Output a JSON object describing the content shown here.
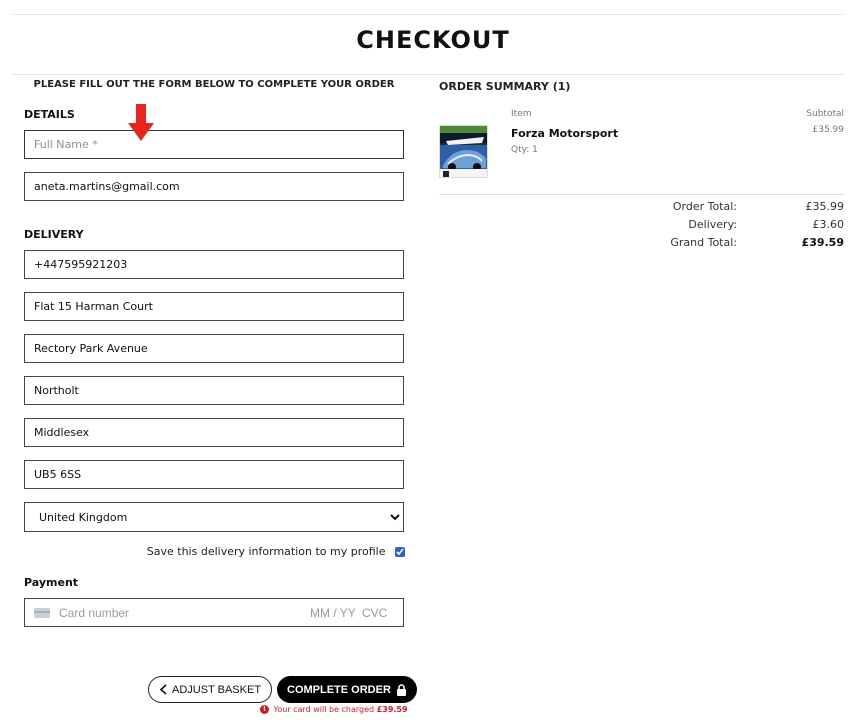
{
  "page": {
    "title": "CHECKOUT",
    "intro": "PLEASE FILL OUT THE FORM BELOW TO COMPLETE YOUR ORDER"
  },
  "details": {
    "label": "DETAILS",
    "full_name_placeholder": "Full Name *",
    "full_name_value": "",
    "email_value": "aneta.martins@gmail.com"
  },
  "delivery": {
    "label": "DELIVERY",
    "phone": "+447595921203",
    "address1": "Flat 15 Harman Court",
    "address2": "Rectory Park Avenue",
    "town": "Northolt",
    "county": "Middlesex",
    "postcode": "UB5 6SS",
    "country": "United Kingdom",
    "save_label": "Save this delivery information to my profile",
    "save_checked": true
  },
  "payment": {
    "label": "Payment",
    "card_placeholder": "Card number",
    "expiry_placeholder": "MM / YY",
    "cvc_placeholder": "CVC"
  },
  "actions": {
    "adjust_label": "ADJUST BASKET",
    "complete_label": "COMPLETE ORDER",
    "charge_note_prefix": "Your card will be charged",
    "charge_amount": "£39.59"
  },
  "summary": {
    "title": "ORDER SUMMARY (1)",
    "col_item": "Item",
    "col_subtotal": "Subtotal",
    "items": [
      {
        "name": "Forza Motorsport",
        "qty": "Qty: 1",
        "subtotal": "£35.99",
        "thumb_icon": "forza-motorsport-cover"
      }
    ],
    "order_total_label": "Order Total:",
    "order_total": "£35.99",
    "delivery_label": "Delivery:",
    "delivery": "£3.60",
    "grand_total_label": "Grand Total:",
    "grand_total": "£39.59"
  },
  "colors": {
    "accent_red": "#e8241c",
    "error_red": "#d11a2a",
    "button_black": "#000000"
  },
  "icons": {
    "annotation": "red-arrow-icon",
    "adjust": "chevron-left-icon",
    "complete": "lock-icon",
    "card": "credit-card-icon",
    "error": "exclamation-circle-icon"
  }
}
